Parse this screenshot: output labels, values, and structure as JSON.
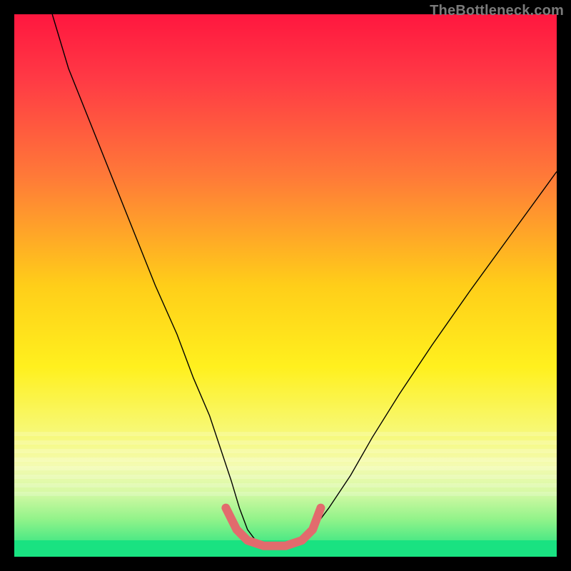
{
  "watermark": "TheBottleneck.com",
  "chart_data": {
    "type": "line",
    "title": "",
    "xlabel": "",
    "ylabel": "",
    "xlim": [
      0,
      100
    ],
    "ylim": [
      0,
      100
    ],
    "gradient_stops": [
      {
        "pos": 0,
        "color": "#ff173f"
      },
      {
        "pos": 12,
        "color": "#ff3a45"
      },
      {
        "pos": 30,
        "color": "#ff7a38"
      },
      {
        "pos": 50,
        "color": "#ffce19"
      },
      {
        "pos": 65,
        "color": "#fff01e"
      },
      {
        "pos": 78,
        "color": "#f6f97e"
      },
      {
        "pos": 83,
        "color": "#f4fbb0"
      },
      {
        "pos": 88,
        "color": "#d7f9a6"
      },
      {
        "pos": 93,
        "color": "#93f38a"
      },
      {
        "pos": 100,
        "color": "#19e281"
      }
    ],
    "banded_strip": {
      "top_pct": 77,
      "height_pct": 12,
      "tint": "rgba(255,255,255,0.18)"
    },
    "green_strip": {
      "top_pct": 97,
      "height_pct": 3,
      "color": "#19e281"
    },
    "series": [
      {
        "name": "bottleneck-curve",
        "stroke": "#000000",
        "stroke_width": 1.4,
        "x": [
          7,
          10,
          14,
          18,
          22,
          26,
          30,
          33,
          36,
          38,
          40,
          41.5,
          43,
          44.5,
          48,
          51,
          53,
          55,
          58,
          62,
          66,
          71,
          77,
          84,
          92,
          100
        ],
        "y": [
          100,
          90,
          80,
          70,
          60,
          50,
          41,
          33,
          26,
          20,
          14,
          9,
          5,
          3,
          2,
          2,
          3,
          5,
          9,
          15,
          22,
          30,
          39,
          49,
          60,
          71
        ]
      },
      {
        "name": "flat-min-marker",
        "stroke": "#e26b6d",
        "stroke_width": 12,
        "linecap": "round",
        "x": [
          39,
          41,
          43,
          46,
          50,
          53,
          55,
          56.5
        ],
        "y": [
          9,
          5,
          3,
          2,
          2,
          3,
          5,
          9
        ]
      }
    ]
  }
}
